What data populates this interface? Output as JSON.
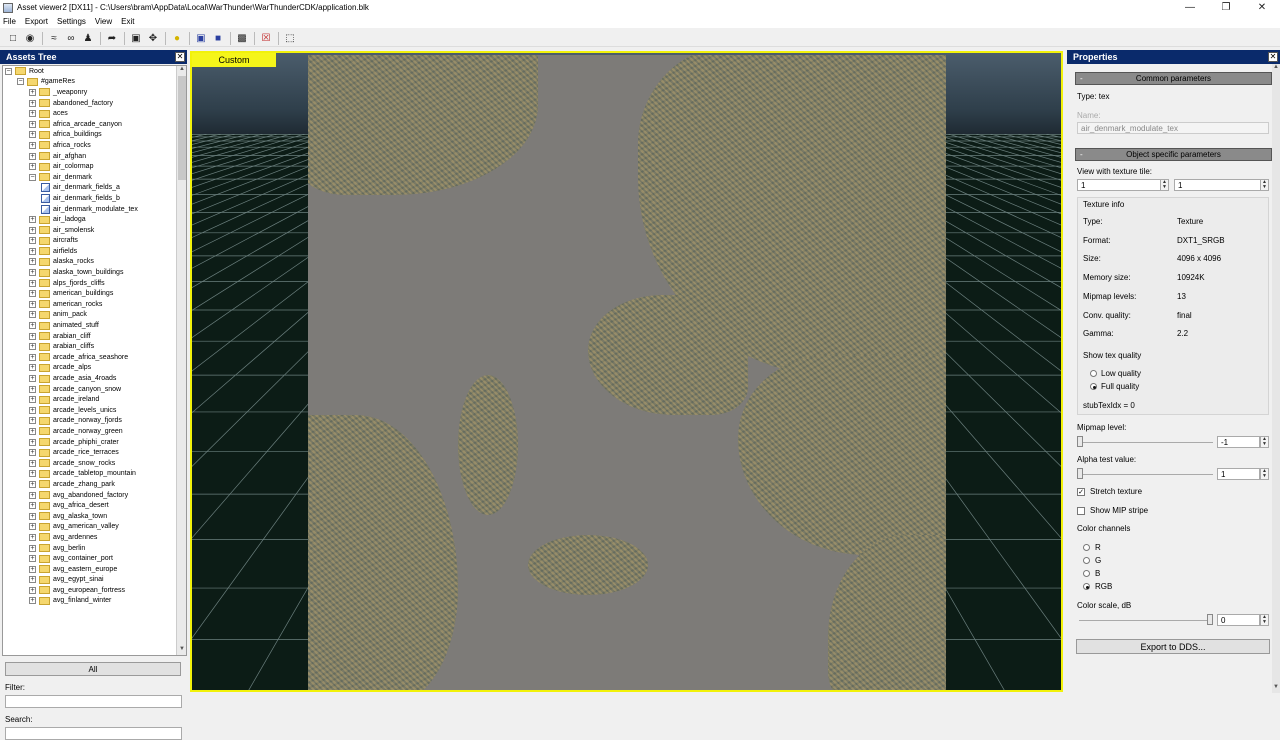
{
  "window": {
    "title": "Asset viewer2  [DX11] - C:\\Users\\bram\\AppData\\Local\\WarThunder\\WarThunderCDK/application.blk",
    "min_icon": "minimize-icon",
    "max_icon": "maximize-icon",
    "close_icon": "close-icon"
  },
  "menu": [
    "File",
    "Export",
    "Settings",
    "View",
    "Exit"
  ],
  "assets_tree": {
    "title": "Assets Tree",
    "root": "Root",
    "gameres": "#gameRes",
    "items": [
      {
        "label": "_weaponry",
        "type": "folder"
      },
      {
        "label": "abandoned_factory",
        "type": "folder"
      },
      {
        "label": "aces",
        "type": "folder"
      },
      {
        "label": "africa_arcade_canyon",
        "type": "folder"
      },
      {
        "label": "africa_buildings",
        "type": "folder"
      },
      {
        "label": "africa_rocks",
        "type": "folder"
      },
      {
        "label": "air_afghan",
        "type": "folder"
      },
      {
        "label": "air_colormap",
        "type": "folder"
      },
      {
        "label": "air_denmark",
        "type": "open"
      },
      {
        "label": "air_denmark_fields_a",
        "type": "tex"
      },
      {
        "label": "air_denmark_fields_b",
        "type": "tex"
      },
      {
        "label": "air_denmark_modulate_tex",
        "type": "tex"
      },
      {
        "label": "air_ladoga",
        "type": "folder"
      },
      {
        "label": "air_smolensk",
        "type": "folder"
      },
      {
        "label": "aircrafts",
        "type": "folder"
      },
      {
        "label": "airfields",
        "type": "folder"
      },
      {
        "label": "alaska_rocks",
        "type": "folder"
      },
      {
        "label": "alaska_town_buildings",
        "type": "folder"
      },
      {
        "label": "alps_fjords_cliffs",
        "type": "folder"
      },
      {
        "label": "american_buildings",
        "type": "folder"
      },
      {
        "label": "american_rocks",
        "type": "folder"
      },
      {
        "label": "anim_pack",
        "type": "folder"
      },
      {
        "label": "animated_stuff",
        "type": "folder"
      },
      {
        "label": "arabian_cliff",
        "type": "folder"
      },
      {
        "label": "arabian_cliffs",
        "type": "folder"
      },
      {
        "label": "arcade_africa_seashore",
        "type": "folder"
      },
      {
        "label": "arcade_alps",
        "type": "folder"
      },
      {
        "label": "arcade_asia_4roads",
        "type": "folder"
      },
      {
        "label": "arcade_canyon_snow",
        "type": "folder"
      },
      {
        "label": "arcade_ireland",
        "type": "folder"
      },
      {
        "label": "arcade_levels_unics",
        "type": "folder"
      },
      {
        "label": "arcade_norway_fjords",
        "type": "folder"
      },
      {
        "label": "arcade_norway_green",
        "type": "folder"
      },
      {
        "label": "arcade_phiphi_crater",
        "type": "folder"
      },
      {
        "label": "arcade_rice_terraces",
        "type": "folder"
      },
      {
        "label": "arcade_snow_rocks",
        "type": "folder"
      },
      {
        "label": "arcade_tabletop_mountain",
        "type": "folder"
      },
      {
        "label": "arcade_zhang_park",
        "type": "folder"
      },
      {
        "label": "avg_abandoned_factory",
        "type": "folder"
      },
      {
        "label": "avg_africa_desert",
        "type": "folder"
      },
      {
        "label": "avg_alaska_town",
        "type": "folder"
      },
      {
        "label": "avg_american_valley",
        "type": "folder"
      },
      {
        "label": "avg_ardennes",
        "type": "folder"
      },
      {
        "label": "avg_berlin",
        "type": "folder"
      },
      {
        "label": "avg_container_port",
        "type": "folder"
      },
      {
        "label": "avg_eastern_europe",
        "type": "folder"
      },
      {
        "label": "avg_egypt_sinai",
        "type": "folder"
      },
      {
        "label": "avg_european_fortress",
        "type": "folder"
      },
      {
        "label": "avg_finland_winter",
        "type": "folder"
      }
    ],
    "all_button": "All",
    "filter_label": "Filter:",
    "filter_value": "",
    "search_label": "Search:",
    "search_value": ""
  },
  "viewport": {
    "tab": "Custom"
  },
  "properties": {
    "title": "Properties",
    "common_section": "Common parameters",
    "type_label": "Type: tex",
    "name_label": "Name:",
    "name_value": "air_denmark_modulate_tex",
    "object_section": "Object specific parameters",
    "view_tile_label": "View with texture tile:",
    "tile_x": "1",
    "tile_y": "1",
    "texture_info": {
      "title": "Texture info",
      "rows": [
        {
          "k": "Type:",
          "v": "Texture"
        },
        {
          "k": "Format:",
          "v": "DXT1_SRGB"
        },
        {
          "k": "Size:",
          "v": "4096 x 4096"
        },
        {
          "k": "Memory size:",
          "v": "10924K"
        },
        {
          "k": "Mipmap levels:",
          "v": "13"
        },
        {
          "k": "Conv. quality:",
          "v": "final"
        },
        {
          "k": "Gamma:",
          "v": "2.2"
        }
      ],
      "show_quality": "Show tex quality",
      "low_quality": "Low quality",
      "full_quality": "Full quality",
      "stub": "stubTexIdx = 0"
    },
    "mipmap_label": "Mipmap level:",
    "mipmap_value": "-1",
    "alpha_label": "Alpha test value:",
    "alpha_value": "1",
    "stretch_label": "Stretch texture",
    "mip_stripe_label": "Show MIP stripe",
    "channels_label": "Color channels",
    "channels": [
      "R",
      "G",
      "B",
      "RGB"
    ],
    "color_scale_label": "Color scale, dB",
    "color_scale_value": "0",
    "export_button": "Export to DDS..."
  }
}
